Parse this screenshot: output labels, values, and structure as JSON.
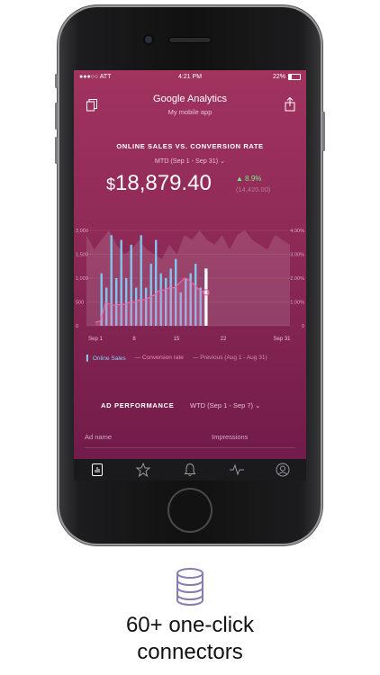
{
  "status_bar": {
    "carrier": "●●●○○ ATT ",
    "time": "4:21 PM",
    "battery": "22%"
  },
  "header": {
    "title": "Google Analytics",
    "subtitle": "My mobile app"
  },
  "report": {
    "title": "ONLINE SALES VS. CONVERSION RATE",
    "date_range": "MTD (Sep 1 - Sep 31)",
    "currency": "$",
    "value": "18,879.40",
    "change": "8.9%",
    "previous": "(14,420.00)"
  },
  "chart_data": {
    "type": "bar",
    "x_ticks": [
      "Sep 1",
      "8",
      "15",
      "22",
      "Sep 31"
    ],
    "y_left_ticks": [
      "2,000",
      "1,500",
      "1,000",
      "500",
      "0"
    ],
    "y_right_ticks": [
      "4.00%",
      "3.00%",
      "2.00%",
      "1.00%",
      "0"
    ],
    "series": [
      {
        "name": "Online Sales",
        "values": [
          0,
          1100,
          800,
          1900,
          1000,
          1800,
          1000,
          1700,
          800,
          1900,
          800,
          1300,
          1800,
          1100,
          1000,
          1200,
          1400,
          700,
          1000,
          1100,
          1300,
          800,
          1200
        ]
      },
      {
        "name": "Conversion rate",
        "values": [
          0.15,
          0.2,
          0.95,
          0.9,
          0.85,
          0.9,
          0.9,
          1.0,
          1.0,
          1.1,
          1.1,
          1.2,
          1.3,
          1.5,
          1.5,
          1.6,
          1.6,
          1.8,
          2.0,
          1.9,
          1.7,
          1.5,
          1.4
        ]
      },
      {
        "name": "Previous (Aug 1 - Aug 31)",
        "values": [
          1900,
          1600,
          1800,
          2000,
          1700,
          1500,
          1600,
          1800,
          1600,
          1500,
          1400,
          1700,
          1500,
          1900,
          1800,
          2000,
          1800,
          1700,
          1900,
          1600,
          1900,
          2000,
          1800,
          1700,
          1600,
          1900,
          1800,
          1700
        ]
      }
    ]
  },
  "legend": {
    "sales": "Online Sales",
    "conversion": "Conversion rate",
    "previous": "Previous (Aug 1 - Aug 31)"
  },
  "ad_performance": {
    "title": "AD PERFORMANCE",
    "date_range": "WTD (Sep 1 - Sep 7)",
    "col_ad": "Ad name",
    "col_impressions": "Impressions"
  },
  "tabs": [
    "reports-icon",
    "star-icon",
    "bell-icon",
    "activity-icon",
    "profile-icon"
  ],
  "promo": {
    "line1": "60+ one-click",
    "line2": "connectors"
  },
  "colors": {
    "bar": "#7fc6f0",
    "line": "#ee6aa7",
    "bg_top": "#a1335f",
    "bg_bottom": "#6e1a49",
    "positive": "#6ef08a"
  }
}
